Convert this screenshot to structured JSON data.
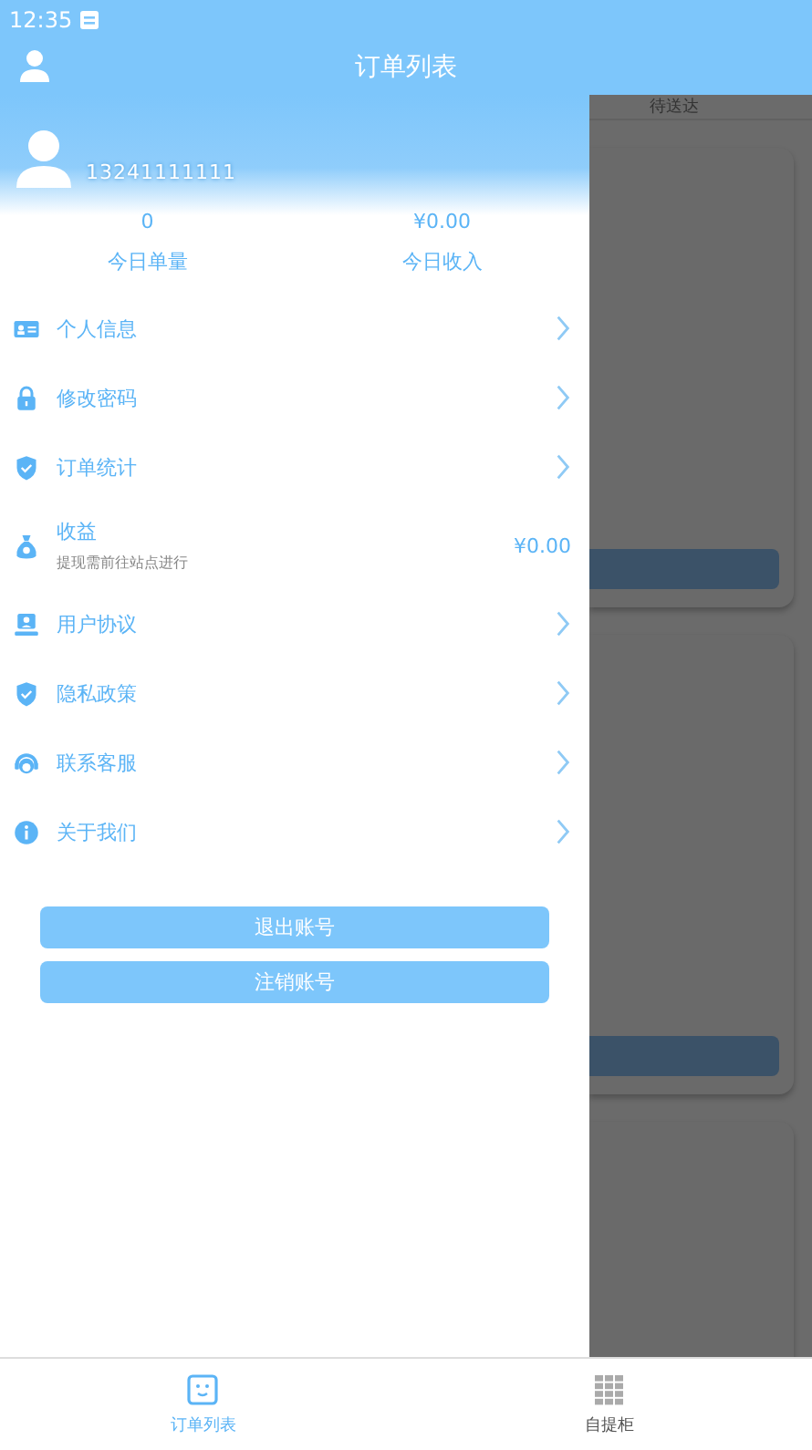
{
  "status_bar": {
    "time": "12:35"
  },
  "header": {
    "title": "订单列表"
  },
  "background_page": {
    "tabs": [
      {
        "label": "待送达"
      }
    ]
  },
  "drawer": {
    "phone": "13241111111",
    "stats": [
      {
        "value": "0",
        "label": "今日单量"
      },
      {
        "value": "¥0.00",
        "label": "今日收入"
      }
    ],
    "menu": [
      {
        "kind": "link",
        "label": "个人信息"
      },
      {
        "kind": "link",
        "label": "修改密码"
      },
      {
        "kind": "link",
        "label": "订单统计"
      },
      {
        "kind": "value",
        "label": "收益",
        "note": "提现需前往站点进行",
        "value": "¥0.00"
      },
      {
        "kind": "link",
        "label": "用户协议"
      },
      {
        "kind": "link",
        "label": "隐私政策"
      },
      {
        "kind": "link",
        "label": "联系客服"
      },
      {
        "kind": "link",
        "label": "关于我们"
      }
    ],
    "buttons": [
      "退出账号",
      "注销账号"
    ]
  },
  "tab_bar": [
    {
      "label": "订单列表",
      "selected": true
    },
    {
      "label": "自提柜",
      "selected": false
    }
  ]
}
